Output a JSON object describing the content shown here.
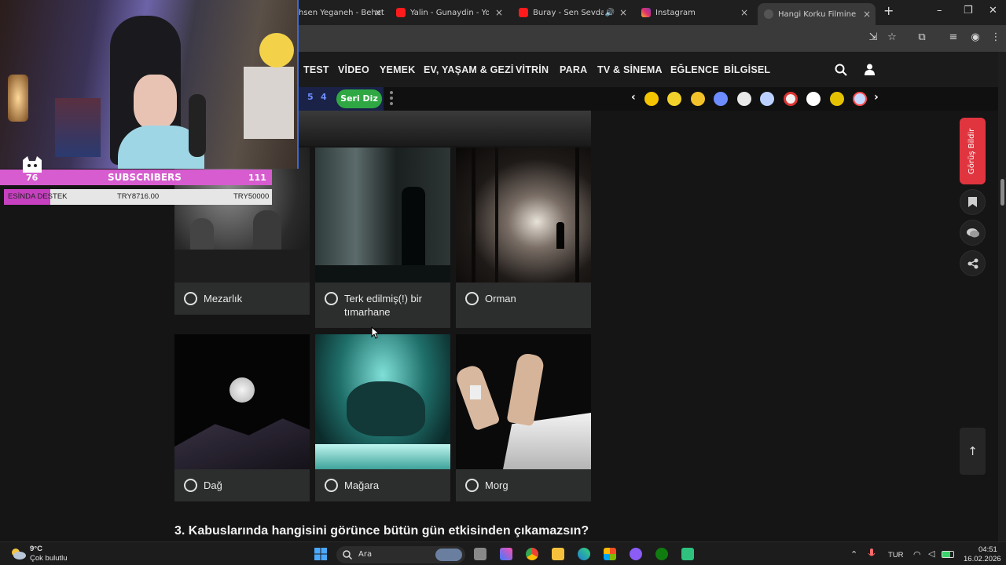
{
  "browser": {
    "tabs": [
      {
        "label": "hsen Yeganeh - Behet",
        "close": "×"
      },
      {
        "label": "Yalin - Gunaydin - YouTub",
        "close": "×"
      },
      {
        "label": "Buray - Sen Sevda Mı",
        "close": "×"
      },
      {
        "label": "Instagram",
        "close": "×"
      },
      {
        "label": "Hangi Korku Filmine Aitsi",
        "close": "×"
      }
    ],
    "new_tab": "+",
    "window_controls": {
      "minimize": "–",
      "maximize": "❐",
      "close": "✕"
    }
  },
  "site_nav": {
    "items": [
      "TEST",
      "VİDEO",
      "YEMEK",
      "EV, YAŞAM & GEZİ",
      "VİTRİN",
      "PARA",
      "TV & SİNEMA",
      "EĞLENCE",
      "BİLGİSEL"
    ]
  },
  "sub_nav": {
    "numbers": [
      "5",
      "4"
    ],
    "seri_diz": "Seri Diz",
    "prev": "‹",
    "next": "›"
  },
  "question_options": [
    {
      "label": "Mezarlık",
      "selected": false
    },
    {
      "label": "Terk edilmiş(!) bir tımarhane",
      "selected": false
    },
    {
      "label": "Orman",
      "selected": false
    },
    {
      "label": "Dağ",
      "selected": false
    },
    {
      "label": "Mağara",
      "selected": false
    },
    {
      "label": "Morg",
      "selected": false
    }
  ],
  "next_question": "3. Kabuslarında hangisini görünce bütün gün etkisinden çıkamazsın?",
  "sidebar": {
    "feedback": "Görüş Bildir",
    "bookmark_icon": "bookmark-icon",
    "comment_icon": "comment-icon",
    "share_icon": "share-icon",
    "to_top": "↑"
  },
  "overlay": {
    "subscribers_count_left": "76",
    "subscribers_label": "SUBSCRIBERS",
    "subscribers_count_right": "111",
    "destek_label": "ESİNDA DESTEK",
    "destek_current": "TRY8716.00",
    "destek_goal": "TRY50000",
    "destek_progress": 0.174
  },
  "taskbar": {
    "weather_temp": "9°C",
    "weather_desc": "Çok bulutlu",
    "search": "Ara",
    "language": "TUR",
    "time": "04:51",
    "date": "16.02.2026"
  },
  "colors": {
    "accent_green": "#2fa844",
    "feedback_red": "#e0353f",
    "overlay_pink": "#d65ccf"
  }
}
